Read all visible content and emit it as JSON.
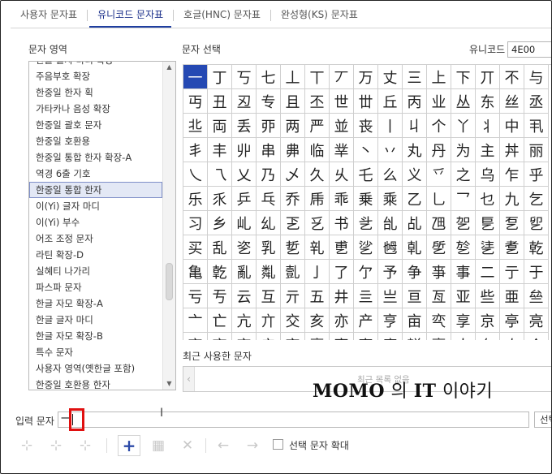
{
  "tabs": [
    "사용자 문자표",
    "유니코드 문자표",
    "호글(HNC) 문자표",
    "완성형(KS) 문자표"
  ],
  "active_tab_index": 1,
  "left_panel": {
    "title": "문자 영역",
    "items": [
      "한글 글자 마디 확장",
      "주음부호 확장",
      "한중일 한자 획",
      "가타카나 음성 확장",
      "한중일 괄호 문자",
      "한중일 호환용",
      "한중일 통합 한자 확장-A",
      "역경 6출 기호",
      "한중일 통합 한자",
      "이(Yi) 글자 마디",
      "이(Yi) 부수",
      "어조 조정 문자",
      "라틴 확장-D",
      "실혜티 나가리",
      "파스파 문자",
      "한글 자모 확장-A",
      "한글 글자 마디",
      "한글 자모 확장-B",
      "특수 문자",
      "사용자 영역(옛한글 포함)",
      "한중일 호환용 한자"
    ],
    "selected_index": 8
  },
  "char_panel": {
    "title": "문자 선택",
    "unicode_label": "유니코드",
    "unicode_value": "4E00",
    "selected_index": 0,
    "chars": [
      "一",
      "丁",
      "丂",
      "七",
      "丄",
      "丅",
      "丆",
      "万",
      "丈",
      "三",
      "上",
      "下",
      "丌",
      "不",
      "与",
      "丏",
      "丑",
      "丒",
      "专",
      "且",
      "丕",
      "世",
      "丗",
      "丘",
      "丙",
      "业",
      "丛",
      "东",
      "丝",
      "丞",
      "丠",
      "両",
      "丢",
      "丣",
      "两",
      "严",
      "並",
      "丧",
      "丨",
      "丩",
      "个",
      "丫",
      "丬",
      "中",
      "丮",
      "丯",
      "丰",
      "丱",
      "串",
      "丳",
      "临",
      "丵",
      "丶",
      "丷",
      "丸",
      "丹",
      "为",
      "主",
      "丼",
      "丽",
      "乀",
      "乁",
      "乂",
      "乃",
      "乄",
      "久",
      "乆",
      "乇",
      "么",
      "义",
      "乊",
      "之",
      "乌",
      "乍",
      "乎",
      "乐",
      "乑",
      "乒",
      "乓",
      "乔",
      "乕",
      "乖",
      "乗",
      "乘",
      "乙",
      "乚",
      "乛",
      "乜",
      "九",
      "乞",
      "习",
      "乡",
      "乢",
      "乣",
      "乤",
      "乥",
      "书",
      "乧",
      "乨",
      "乩",
      "乪",
      "乫",
      "乬",
      "乭",
      "乮",
      "买",
      "乱",
      "乲",
      "乳",
      "乴",
      "乵",
      "乶",
      "乷",
      "乸",
      "乹",
      "乺",
      "乻",
      "乼",
      "乽",
      "乾",
      "亀",
      "亁",
      "亂",
      "亃",
      "亄",
      "亅",
      "了",
      "亇",
      "予",
      "争",
      "亊",
      "事",
      "二",
      "亍",
      "于",
      "亏",
      "亐",
      "云",
      "互",
      "亓",
      "五",
      "井",
      "亖",
      "亗",
      "亘",
      "亙",
      "亚",
      "些",
      "亜",
      "亝",
      "亠",
      "亡",
      "亢",
      "亣",
      "交",
      "亥",
      "亦",
      "产",
      "亨",
      "亩",
      "亪",
      "享",
      "京",
      "亭",
      "亮",
      "亯",
      "亰",
      "亱",
      "亲",
      "亳",
      "亴",
      "亵",
      "亶",
      "亷",
      "亸",
      "亹",
      "人",
      "亻",
      "亼",
      "亽"
    ]
  },
  "recent": {
    "title": "최근 사용한 문자",
    "empty_text": "최근 목록 없음"
  },
  "watermark": {
    "brand": "MOMO",
    "middle": " 의 ",
    "it": "IT",
    "tail": " 이야기"
  },
  "input_row": {
    "label": "입력 문자",
    "value": "一",
    "select_button_label": "선택"
  },
  "toolbar": {
    "zoom_label": "선택 문자 확대",
    "buttons": [
      {
        "icon": "add-to-user-icon",
        "glyph": "⊹",
        "active": false
      },
      {
        "icon": "edit-user-icon",
        "glyph": "⊹",
        "active": false
      },
      {
        "icon": "delete-user-icon",
        "glyph": "⊹",
        "active": false
      },
      {
        "icon": "plus-icon",
        "glyph": "+",
        "active": true
      },
      {
        "icon": "insert-icon",
        "glyph": "▦",
        "active": false
      },
      {
        "icon": "remove-icon",
        "glyph": "✕",
        "active": false
      },
      {
        "icon": "arrow-left-icon",
        "glyph": "←",
        "active": false
      },
      {
        "icon": "arrow-right-icon",
        "glyph": "→",
        "active": false
      }
    ]
  },
  "colors": {
    "accent": "#2549b3",
    "highlight": "#e01010"
  }
}
